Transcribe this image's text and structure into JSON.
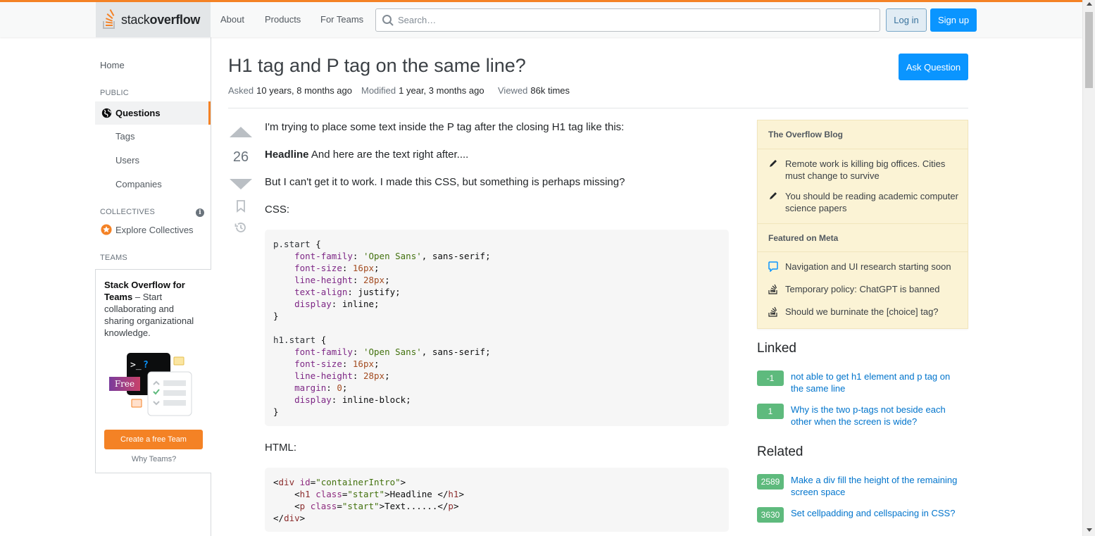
{
  "header": {
    "logo": {
      "word1": "stack",
      "word2": "overflow"
    },
    "nav": [
      "About",
      "Products",
      "For Teams"
    ],
    "search_placeholder": "Search…",
    "login_label": "Log in",
    "signup_label": "Sign up",
    "accent_color": "#f48225",
    "primary_color": "#0a95ff"
  },
  "sidebar": {
    "home": "Home",
    "public_label": "PUBLIC",
    "questions": "Questions",
    "tags": "Tags",
    "users": "Users",
    "companies": "Companies",
    "collectives_label": "COLLECTIVES",
    "info_glyph": "i",
    "explore_collectives": "Explore Collectives",
    "teams_label": "TEAMS",
    "teams_promo": {
      "title": "Stack Overflow for Teams",
      "dash": " – ",
      "body": "Start collaborating and sharing organizational knowledge.",
      "badge": "Free",
      "terminal": ">_?",
      "cta": "Create a free Team",
      "why": "Why Teams?"
    }
  },
  "question": {
    "title": "H1 tag and P tag on the same line?",
    "ask_button": "Ask Question",
    "asked_label": "Asked",
    "asked_value": "10 years, 8 months ago",
    "modified_label": "Modified",
    "modified_value": "1 year, 3 months ago",
    "viewed_label": "Viewed",
    "viewed_value": "86k times",
    "votes": "26",
    "body": {
      "p1": "I'm trying to place some text inside the P tag after the closing H1 tag like this:",
      "p2_bold": "Headline",
      "p2_rest": " And here are the text right after....",
      "p3": "But I can't get it to work. I made this CSS, but something is perhaps missing?",
      "css_label": "CSS:",
      "html_label": "HTML:"
    }
  },
  "blog": {
    "heading1": "The Overflow Blog",
    "items1": [
      "Remote work is killing big offices. Cities must change to survive",
      "You should be reading academic computer science papers"
    ],
    "heading2": "Featured on Meta",
    "items2": [
      "Navigation and UI research starting soon",
      "Temporary policy: ChatGPT is banned",
      "Should we burninate the [choice] tag?"
    ]
  },
  "linked": {
    "heading": "Linked",
    "items": [
      {
        "score": "-1",
        "text": "not able to get h1 element and p tag on the same line"
      },
      {
        "score": "1",
        "text": "Why is the two p-tags not beside each other when the screen is wide?"
      }
    ]
  },
  "related": {
    "heading": "Related",
    "items": [
      {
        "score": "2589",
        "text": "Make a div fill the height of the remaining screen space"
      },
      {
        "score": "3630",
        "text": "Set cellpadding and cellspacing in CSS?"
      }
    ]
  }
}
